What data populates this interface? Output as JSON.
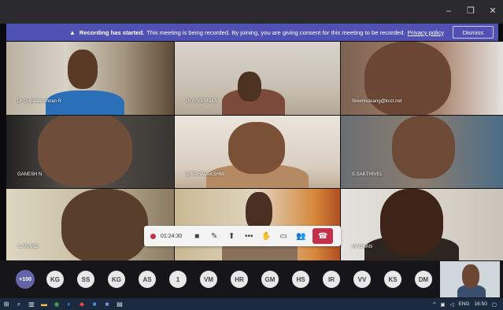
{
  "window": {
    "controls": {
      "minimize": "–",
      "restore": "❐",
      "close": "✕"
    }
  },
  "banner": {
    "icon": "warning-icon",
    "bold": "Recording has started.",
    "text": "This meeting is being recorded. By joining, you are giving consent for this meeting to be recorded.",
    "link": "Privacy policy",
    "dismiss_label": "Dismiss"
  },
  "participants": [
    {
      "name": "Dr Gopalakrishnan R"
    },
    {
      "name": "Dr G VENNILA"
    },
    {
      "name": "Sreenivasang@kcct.net"
    },
    {
      "name": "GANESH N"
    },
    {
      "name": "S MAHALAKSHMI"
    },
    {
      "name": "S.SAKTHIVEL"
    },
    {
      "name": "S.ANAND"
    },
    {
      "name": ""
    },
    {
      "name": "MADHAN"
    }
  ],
  "controls": {
    "timer": "01:24:30",
    "icons": [
      "camera-icon",
      "mic-off-icon",
      "share-icon",
      "more-icon",
      "raise-hand-icon",
      "chat-icon",
      "participants-icon",
      "hang-up-icon"
    ]
  },
  "participant_bar": {
    "more_count": "+100",
    "initials": [
      "KG",
      "SS",
      "KG",
      "AS",
      "1",
      "VM",
      "HR",
      "GM",
      "HS",
      "IR",
      "VV",
      "KS",
      "DM"
    ]
  },
  "taskbar": {
    "lang": "ENG",
    "time": "16:50"
  },
  "colors": {
    "banner": "#4f52b2",
    "hangup": "#c4314b",
    "titlebar": "#2a2a2e"
  }
}
